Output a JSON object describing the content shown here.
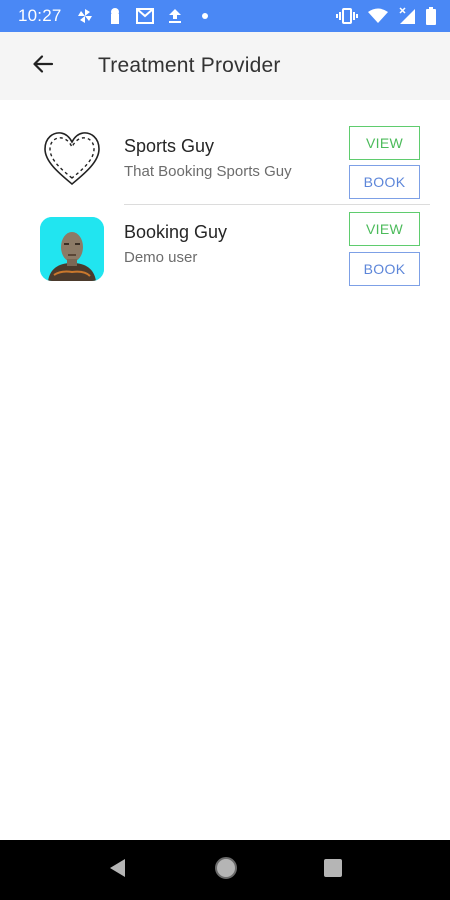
{
  "status_bar": {
    "time": "10:27",
    "left_icons": [
      "pinwheel-icon",
      "keyhole-icon",
      "gmail-icon",
      "upload-icon",
      "dot-icon"
    ],
    "right_icons": [
      "vibrate-icon",
      "wifi-icon",
      "signal-icon",
      "battery-icon"
    ]
  },
  "app_bar": {
    "title": "Treatment Provider",
    "back_icon": "arrow-back-icon"
  },
  "providers": [
    {
      "name": "Sports Guy",
      "subtitle": "That Booking Sports Guy",
      "avatar": "heart-outline-avatar",
      "view_label": "VIEW",
      "book_label": "BOOK"
    },
    {
      "name": "Booking Guy",
      "subtitle": "Demo user",
      "avatar": "person-photo-avatar",
      "view_label": "VIEW",
      "book_label": "BOOK"
    }
  ],
  "nav_bar": {
    "icons": [
      "nav-back-icon",
      "nav-home-icon",
      "nav-recents-icon"
    ]
  },
  "colors": {
    "status_bar": "#4a88f5",
    "app_bar": "#f5f5f5",
    "view_button": "#4cbb5b",
    "book_button": "#5d86d9",
    "avatar_bg": "#21e5f0"
  }
}
